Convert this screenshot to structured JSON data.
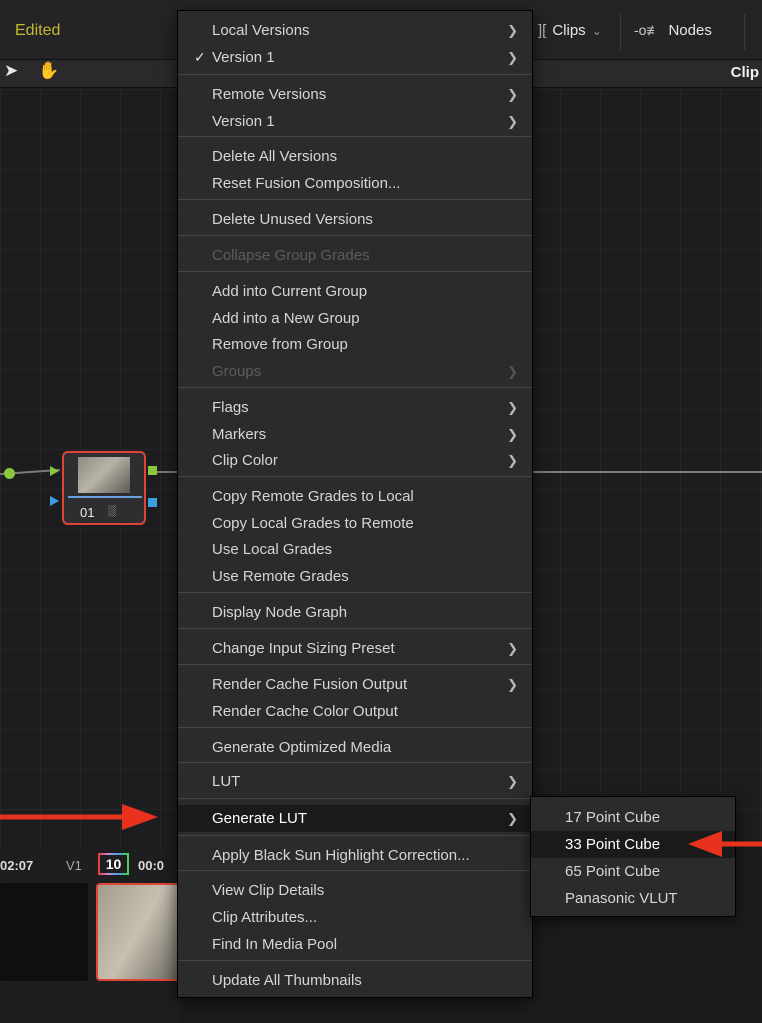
{
  "app": {
    "status": "Edited",
    "clips_label": "Clips",
    "nodes_label": "Nodes",
    "clip_label": "Clip"
  },
  "node": {
    "number": "01",
    "icon": "bars-icon"
  },
  "timeline": {
    "tc1": "02:07",
    "track": "V1",
    "clip_number": "10",
    "tc2": "00:0"
  },
  "menu": {
    "items": [
      {
        "label": "Local Versions",
        "submenu": true
      },
      {
        "label": "Version 1",
        "submenu": true,
        "checked": true
      },
      {
        "label": "Remote Versions",
        "submenu": true
      },
      {
        "label": "Version 1",
        "submenu": true
      },
      {
        "label": "Delete All Versions"
      },
      {
        "label": "Reset Fusion Composition..."
      },
      {
        "label": "Delete Unused Versions"
      },
      {
        "label": "Collapse Group Grades",
        "disabled": true
      },
      {
        "label": "Add into Current Group"
      },
      {
        "label": "Add into a New Group"
      },
      {
        "label": "Remove from Group"
      },
      {
        "label": "Groups",
        "disabled": true,
        "submenu": true
      },
      {
        "label": "Flags",
        "submenu": true
      },
      {
        "label": "Markers",
        "submenu": true
      },
      {
        "label": "Clip Color",
        "submenu": true
      },
      {
        "label": "Copy Remote Grades to Local"
      },
      {
        "label": "Copy Local Grades to Remote"
      },
      {
        "label": "Use Local Grades"
      },
      {
        "label": "Use Remote Grades"
      },
      {
        "label": "Display Node Graph"
      },
      {
        "label": "Change Input Sizing Preset",
        "submenu": true
      },
      {
        "label": "Render Cache Fusion Output",
        "submenu": true
      },
      {
        "label": "Render Cache Color Output"
      },
      {
        "label": "Generate Optimized Media"
      },
      {
        "label": "LUT",
        "submenu": true
      },
      {
        "label": "Generate LUT",
        "submenu": true,
        "active": true
      },
      {
        "label": "Apply Black Sun Highlight Correction..."
      },
      {
        "label": "View Clip Details"
      },
      {
        "label": "Clip Attributes..."
      },
      {
        "label": "Find In Media Pool"
      },
      {
        "label": "Update All Thumbnails"
      }
    ]
  },
  "submenu": {
    "items": [
      {
        "label": "17 Point Cube"
      },
      {
        "label": "33 Point Cube",
        "active": true
      },
      {
        "label": "65 Point Cube"
      },
      {
        "label": "Panasonic VLUT"
      }
    ]
  },
  "colors": {
    "accent_red": "#e8321e",
    "edited_yellow": "#c8b833",
    "menu_bg": "#2b2b2d",
    "highlight_bg": "#1a1a1b"
  }
}
